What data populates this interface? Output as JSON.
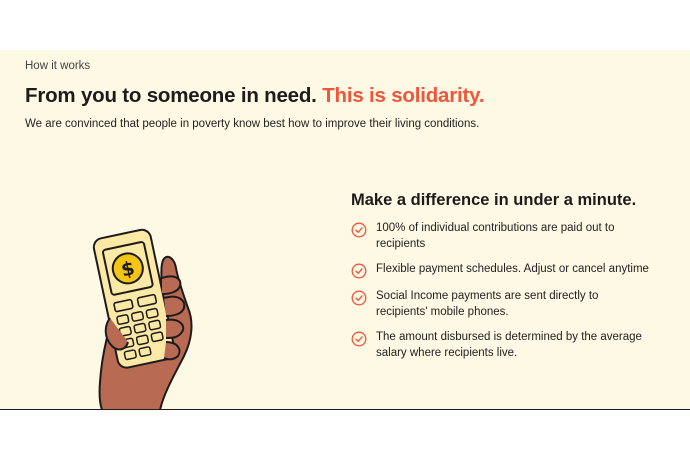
{
  "section": {
    "eyebrow": "How it works",
    "headline": "From you to someone in need.",
    "headline_accent": "This is solidarity.",
    "intro": "We are convinced that people in poverty know best how to improve their living conditions."
  },
  "benefits": {
    "title": "Make a difference in under a minute.",
    "items": [
      {
        "text": "100% of individual contributions are paid out to recipients"
      },
      {
        "text": "Flexible payment schedules. Adjust or cancel anytime"
      },
      {
        "text": "Social Income payments are sent directly to recipients' mobile phones."
      },
      {
        "text": "The amount disbursed is determined by the average salary where recipients live."
      }
    ]
  },
  "illustration": {
    "icon": "hand-holding-phone-dollar-icon",
    "symbol": "$"
  },
  "colors": {
    "accent": "#f0563b",
    "background": "#fef9e4",
    "phone": "#fbe9a5",
    "coin": "#f4c416",
    "skin": "#b86a52"
  }
}
